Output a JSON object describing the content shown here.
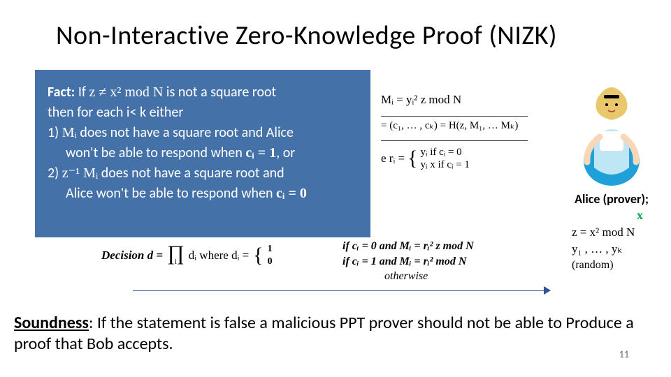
{
  "title": "Non-Interactive Zero-Knowledge Proof (NIZK)",
  "fact": {
    "label": "Fact:",
    "line1_a": " If ",
    "line1_math": "z ≠ x² mod N",
    "line1_b": "  is not a square root",
    "line2": "then for each i< k either",
    "item1_a": "1) ",
    "item1_math": "Mᵢ",
    "item1_b": " does not have a square root  and Alice",
    "item1_c": "won't be able to respond when ",
    "item1_cond": "cᵢ = 1",
    "item1_d": ", or",
    "item2_a": "2) ",
    "item2_math": "z⁻¹ Mᵢ",
    "item2_b": " does not have a square root and",
    "item2_c": "Alice won't be able to respond when ",
    "item2_cond": "cᵢ = 0"
  },
  "right": {
    "m": "Mᵢ = yᵢ² z mod N",
    "h": "= (c₁, … , cₖ) = H(z, M₁, … Mₖ)",
    "r_prefix": "e rᵢ =",
    "r_case1": "yᵢ         if cᵢ = 0",
    "r_case2": "yᵢ x      if cᵢ = 1"
  },
  "decision": {
    "text": "Decision d =",
    "prod_sub": "i",
    "mid": "dᵢ   where dᵢ =",
    "case1": "1",
    "case2": "0"
  },
  "cond": {
    "c0": "if cᵢ = 0 and Mᵢ = rᵢ² z mod N",
    "c1": "if cᵢ = 1 and Mᵢ = rᵢ² mod N",
    "other": "otherwise"
  },
  "alice": {
    "label": "Alice (prover);",
    "x": "x",
    "z": "z = x² mod N",
    "y": "y₁ , … , yₖ",
    "rand": "(random)"
  },
  "soundness": {
    "label": "Soundness",
    "text": ": If the statement is false a malicious PPT prover should not be able to Produce a proof that Bob accepts."
  },
  "page": "11"
}
